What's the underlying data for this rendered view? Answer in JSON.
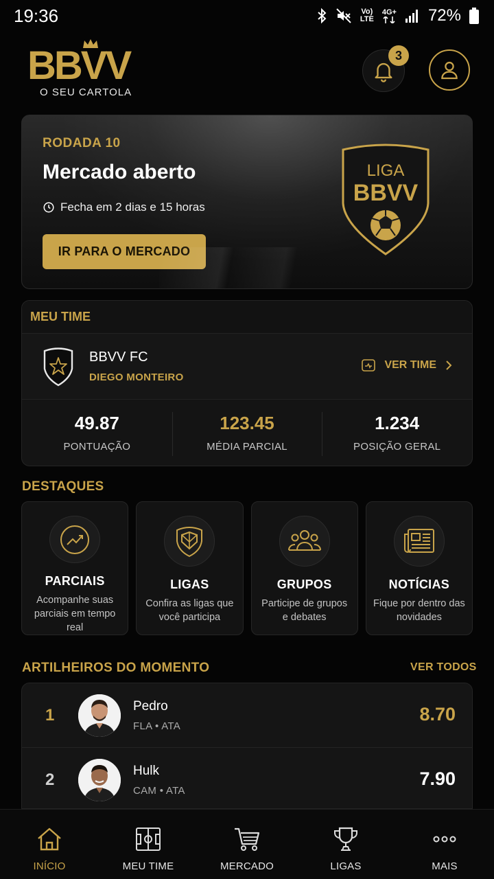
{
  "status_bar": {
    "time": "19:36",
    "battery": "72%",
    "net_top": "Vo)",
    "net_bottom": "LTE",
    "net_gen": "4G+"
  },
  "header": {
    "logo_text": "BBVV",
    "logo_tagline": "O SEU CARTOLA",
    "notifications_count": "3"
  },
  "round": {
    "label": "RODADA 10",
    "title": "Mercado aberto",
    "closes": "Fecha em 2 dias e 15 horas",
    "button": "IR PARA O MERCADO",
    "league_top": "LIGA",
    "league_bottom": "BBVV"
  },
  "my_team": {
    "section": "MEU TIME",
    "name": "BBVV FC",
    "owner": "DIEGO MONTEIRO",
    "view_label": "VER TIME",
    "stats": [
      {
        "value": "49.87",
        "label": "PONTUAÇÃO"
      },
      {
        "value": "123.45",
        "label": "MÉDIA PARCIAL"
      },
      {
        "value": "1.234",
        "label": "POSIÇÃO GERAL"
      }
    ]
  },
  "highlights": {
    "section": "DESTAQUES",
    "items": [
      {
        "title": "PARCIAIS",
        "desc": "Acompanhe suas parciais em tempo real",
        "icon": "trending-up-icon"
      },
      {
        "title": "LIGAS",
        "desc": "Confira as ligas que você participa",
        "icon": "shield-icon"
      },
      {
        "title": "GRUPOS",
        "desc": "Participe de grupos e debates",
        "icon": "group-icon"
      },
      {
        "title": "NOTÍCIAS",
        "desc": "Fique por dentro das novidades",
        "icon": "newspaper-icon"
      }
    ]
  },
  "scorers": {
    "section": "ARTILHEIROS DO MOMENTO",
    "see_all": "VER TODOS",
    "items": [
      {
        "rank": "1",
        "name": "Pedro",
        "meta": "FLA • ATA",
        "score": "8.70"
      },
      {
        "rank": "2",
        "name": "Hulk",
        "meta": "CAM • ATA",
        "score": "7.90"
      }
    ]
  },
  "nav": {
    "items": [
      {
        "label": "INÍCIO",
        "icon": "home-icon"
      },
      {
        "label": "MEU TIME",
        "icon": "field-icon"
      },
      {
        "label": "MERCADO",
        "icon": "cart-icon"
      },
      {
        "label": "LIGAS",
        "icon": "trophy-icon"
      },
      {
        "label": "MAIS",
        "icon": "more-icon"
      }
    ]
  },
  "colors": {
    "accent": "#c9a44a",
    "background": "#050505",
    "card": "#141414"
  }
}
